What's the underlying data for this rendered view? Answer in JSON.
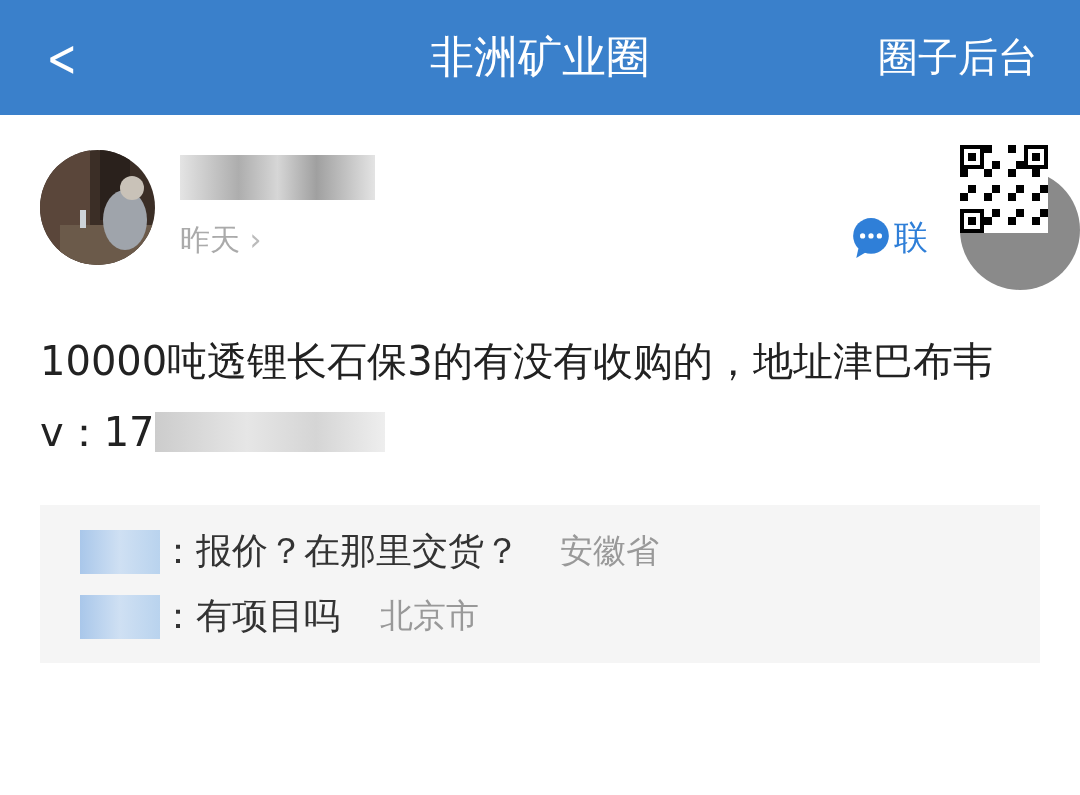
{
  "header": {
    "back": "<",
    "title": "非洲矿业圈",
    "action": "圈子后台"
  },
  "post": {
    "time": "昨天",
    "time_arrow": "›",
    "contact": {
      "label": "联"
    },
    "content": "10000吨透锂长石保3的有没有收购的，地址津巴布韦",
    "contact_line": "v：17",
    "comments": [
      {
        "separator": "：",
        "text": "报价？在那里交货？",
        "location": "安徽省"
      },
      {
        "separator": "：",
        "text": "有项目吗",
        "location": "北京市"
      }
    ]
  }
}
